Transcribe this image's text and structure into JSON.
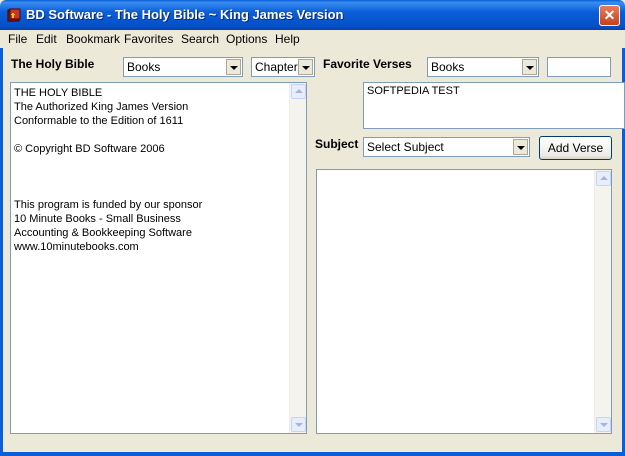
{
  "window": {
    "title": "BD Software - The Holy Bible ~ King James Version",
    "close_glyph": "✕"
  },
  "menu": [
    "File",
    "Edit",
    "Bookmark",
    "Favorites",
    "Search",
    "Options",
    "Help"
  ],
  "left": {
    "heading": "The Holy Bible",
    "books_value": "Books",
    "chapter_value": "Chapter",
    "lines": [
      "THE HOLY BIBLE",
      "The Authorized King James Version",
      "Conformable to the Edition of 1611",
      "",
      "© Copyright BD Software 2006",
      "",
      "",
      "",
      "This program is funded by our sponsor",
      "10 Minute Books - Small Business",
      "Accounting & Bookkeeping Software",
      "www.10minutebooks.com"
    ]
  },
  "right": {
    "heading": "Favorite Verses",
    "books_value": "Books",
    "verse_input_value": "",
    "favorite_text": "SOFTPEDIA TEST",
    "subject_label": "Subject",
    "subject_value": "Select Subject",
    "add_verse_label": "Add Verse"
  },
  "icons": {
    "app": "bible-book-icon"
  }
}
